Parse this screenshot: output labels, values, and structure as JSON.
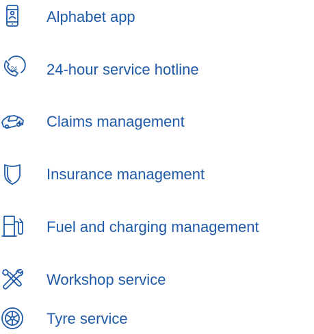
{
  "accent_color": "#1f5aa8",
  "services": [
    {
      "label": "Alphabet app",
      "icon": "smartphone-icon"
    },
    {
      "label": "24-hour service hotline",
      "icon": "phone-24-icon"
    },
    {
      "label": "Claims management",
      "icon": "damaged-car-icon"
    },
    {
      "label": "Insurance management",
      "icon": "shield-icon"
    },
    {
      "label": "Fuel and charging management",
      "icon": "fuel-pump-icon"
    },
    {
      "label": "Workshop service",
      "icon": "tools-icon"
    },
    {
      "label": "Tyre service",
      "icon": "tyre-icon"
    }
  ]
}
